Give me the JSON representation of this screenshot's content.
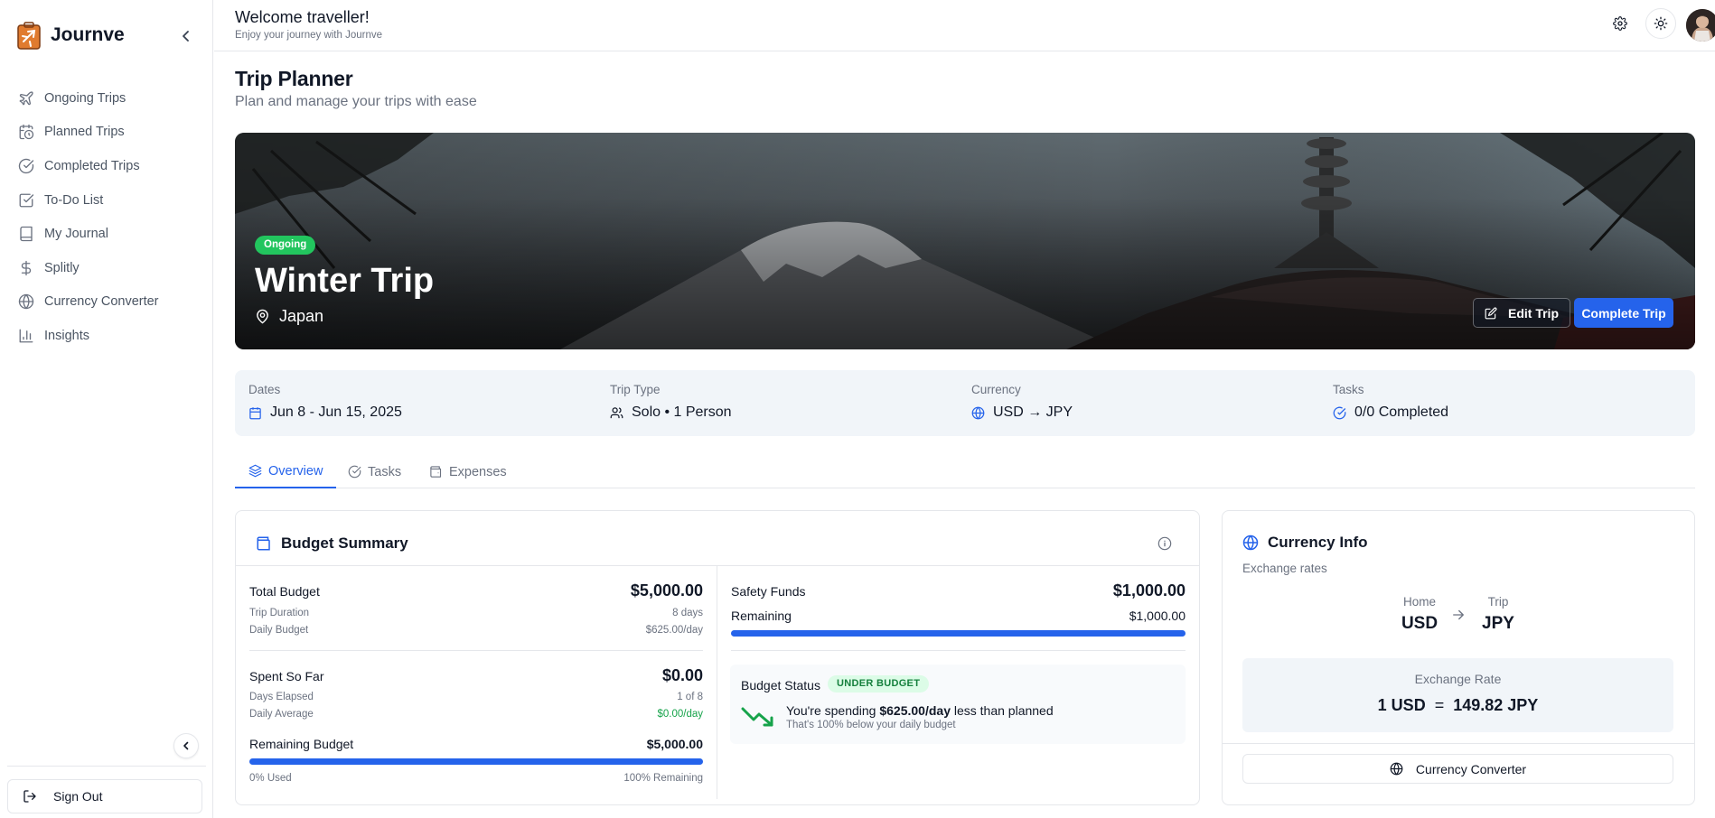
{
  "app": {
    "name": "Journve"
  },
  "sidebar": {
    "items": [
      {
        "label": "Ongoing Trips",
        "icon": "plane-icon"
      },
      {
        "label": "Planned Trips",
        "icon": "calendar-clock-icon"
      },
      {
        "label": "Completed Trips",
        "icon": "check-circle-icon"
      },
      {
        "label": "To-Do List",
        "icon": "check-square-icon"
      },
      {
        "label": "My Journal",
        "icon": "book-icon"
      },
      {
        "label": "Splitly",
        "icon": "dollar-icon"
      },
      {
        "label": "Currency Converter",
        "icon": "globe-icon"
      },
      {
        "label": "Insights",
        "icon": "bar-chart-icon"
      }
    ],
    "sign_out": "Sign Out"
  },
  "header": {
    "welcome": "Welcome traveller!",
    "subtitle": "Enjoy your journey with Journve"
  },
  "page": {
    "title": "Trip Planner",
    "subtitle": "Plan and manage your trips with ease"
  },
  "trip": {
    "status": "Ongoing",
    "title": "Winter Trip",
    "location": "Japan",
    "edit_label": "Edit Trip",
    "complete_label": "Complete Trip"
  },
  "info": {
    "dates_label": "Dates",
    "dates_value": "Jun 8 - Jun 15, 2025",
    "type_label": "Trip Type",
    "type_value": "Solo • 1 Person",
    "currency_label": "Currency",
    "currency_value": "USD → JPY",
    "tasks_label": "Tasks",
    "tasks_value": "0/0 Completed"
  },
  "tabs": [
    {
      "label": "Overview",
      "active": true
    },
    {
      "label": "Tasks",
      "active": false
    },
    {
      "label": "Expenses",
      "active": false
    }
  ],
  "budget": {
    "title": "Budget Summary",
    "total_label": "Total Budget",
    "total_value": "$5,000.00",
    "duration_label": "Trip Duration",
    "duration_value": "8 days",
    "daily_label": "Daily Budget",
    "daily_value": "$625.00/day",
    "spent_label": "Spent So Far",
    "spent_value": "$0.00",
    "elapsed_label": "Days Elapsed",
    "elapsed_value": "1 of 8",
    "avg_label": "Daily Average",
    "avg_value": "$0.00/day",
    "remaining_label": "Remaining Budget",
    "remaining_value": "$5,000.00",
    "remaining_fraction": 1.0,
    "used_label": "0% Used",
    "remaining_pct_label": "100% Remaining",
    "safety_label": "Safety Funds",
    "safety_value": "$1,000.00",
    "safety_remaining_label": "Remaining",
    "safety_remaining_value": "$1,000.00",
    "safety_fraction": 1.0,
    "status_label": "Budget Status",
    "status_badge": "UNDER BUDGET",
    "status_prefix": "You're spending ",
    "status_amount": "$625.00/day",
    "status_suffix": " less than planned",
    "status_note": "That's 100% below your daily budget"
  },
  "currency": {
    "title": "Currency Info",
    "subtitle": "Exchange rates",
    "home_label": "Home",
    "home_code": "USD",
    "trip_label": "Trip",
    "trip_code": "JPY",
    "rate_label": "Exchange Rate",
    "rate_from": "1 USD",
    "rate_eq": "=",
    "rate_to": "149.82 JPY",
    "converter_label": "Currency Converter"
  },
  "colors": {
    "accent": "#2563eb",
    "success": "#22c55e",
    "success_text": "#16a34a"
  }
}
